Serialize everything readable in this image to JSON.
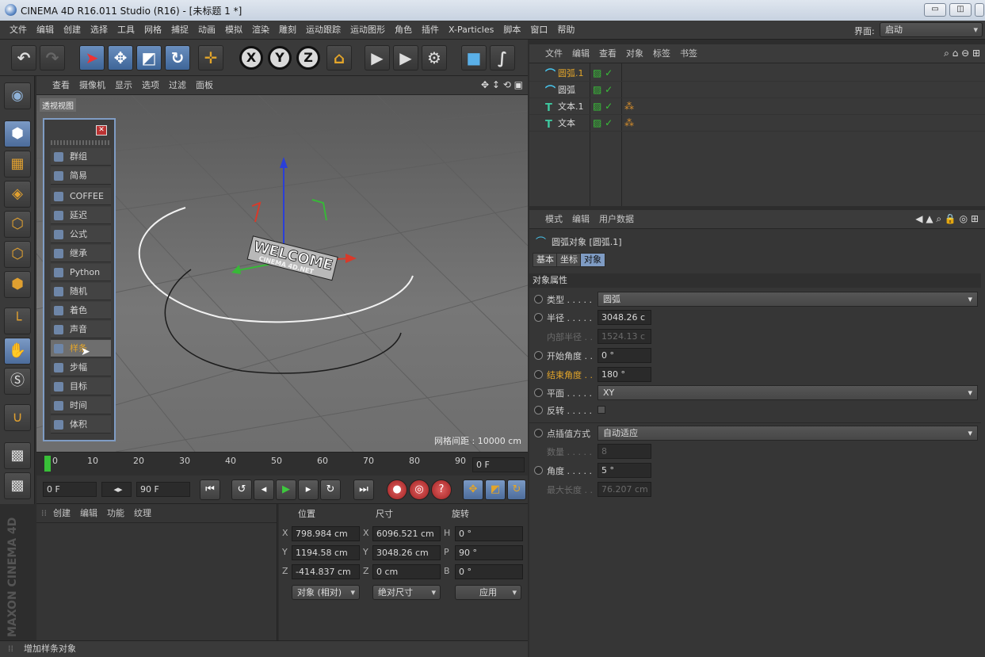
{
  "titlebar": {
    "title": "CINEMA 4D R16.011 Studio (R16) - [未标题 1 *]",
    "minimize": "▭",
    "restore": "◫",
    "close": "✕"
  },
  "menubar": {
    "items": [
      "文件",
      "编辑",
      "创建",
      "选择",
      "工具",
      "网格",
      "捕捉",
      "动画",
      "模拟",
      "渲染",
      "雕刻",
      "运动跟踪",
      "运动图形",
      "角色",
      "插件",
      "X-Particles",
      "脚本",
      "窗口",
      "帮助"
    ],
    "layout_label": "界面:",
    "layout_value": "启动"
  },
  "viewport": {
    "menu": [
      "查看",
      "摄像机",
      "显示",
      "选项",
      "过滤",
      "面板"
    ],
    "label": "透视视图",
    "grid_spacing": "网格间距 : 10000 cm",
    "welcome_text": "WELCOME",
    "welcome_sub": "CINEMA 4D.NET"
  },
  "popup": {
    "items": [
      "群组",
      "简易",
      "COFFEE",
      "延迟",
      "公式",
      "继承",
      "Python",
      "随机",
      "着色",
      "声音",
      "样条",
      "步幅",
      "目标",
      "时间",
      "体积"
    ],
    "highlighted": "样条"
  },
  "timeline": {
    "ticks": [
      "0",
      "10",
      "20",
      "30",
      "40",
      "50",
      "60",
      "70",
      "80",
      "90"
    ],
    "current_frame": "0 F",
    "start_frame": "0 F",
    "end_frame": "90 F"
  },
  "materials": {
    "menu": [
      "创建",
      "编辑",
      "功能",
      "纹理"
    ]
  },
  "coordinates": {
    "headers": [
      "位置",
      "尺寸",
      "旋转"
    ],
    "position": {
      "x": "798.984 cm",
      "y": "1194.58 cm",
      "z": "-414.837 cm"
    },
    "size": {
      "x": "6096.521 cm",
      "y": "3048.26 cm",
      "z": "0 cm"
    },
    "rotation": {
      "h": "0 °",
      "p": "90 °",
      "b": "0 °"
    },
    "mode": "对象 (相对)",
    "size_mode": "绝对尺寸",
    "apply": "应用"
  },
  "statusbar": {
    "text": "增加样条对象"
  },
  "object_manager": {
    "menu": [
      "文件",
      "编辑",
      "查看",
      "对象",
      "标签",
      "书签"
    ],
    "objects": [
      {
        "name": "圆弧.1",
        "icon": "arc",
        "selected": true,
        "tag": ""
      },
      {
        "name": "圆弧",
        "icon": "arc",
        "selected": false,
        "tag": ""
      },
      {
        "name": "文本.1",
        "icon": "text",
        "selected": false,
        "tag": "⁂"
      },
      {
        "name": "文本",
        "icon": "text",
        "selected": false,
        "tag": "⁂"
      }
    ]
  },
  "attributes": {
    "menu": [
      "模式",
      "编辑",
      "用户数据"
    ],
    "object_title": "圆弧对象 [圆弧.1]",
    "tabs": [
      "基本",
      "坐标",
      "对象"
    ],
    "section": "对象属性",
    "type_label": "类型 . . . . .",
    "type_value": "圆弧",
    "radius_label": "半径 . . . . .",
    "radius_value": "3048.26 c",
    "inner_label": "内部半径 . .",
    "inner_value": "1524.13 c",
    "start_label": "开始角度 . .",
    "start_value": "0 °",
    "end_label": "结束角度 . .",
    "end_value": "180 °",
    "plane_label": "平面 . . . . .",
    "plane_value": "XY",
    "reverse_label": "反转 . . . . .",
    "interp_label": "点插值方式",
    "interp_value": "自动适应",
    "count_label": "数量 . . . . .",
    "count_value": "8",
    "angle_label": "角度 . . . . .",
    "angle_value": "5 °",
    "maxlen_label": "最大长度 . .",
    "maxlen_value": "76.207 cm"
  },
  "brand": {
    "text": "MAXON CINEMA 4D"
  }
}
